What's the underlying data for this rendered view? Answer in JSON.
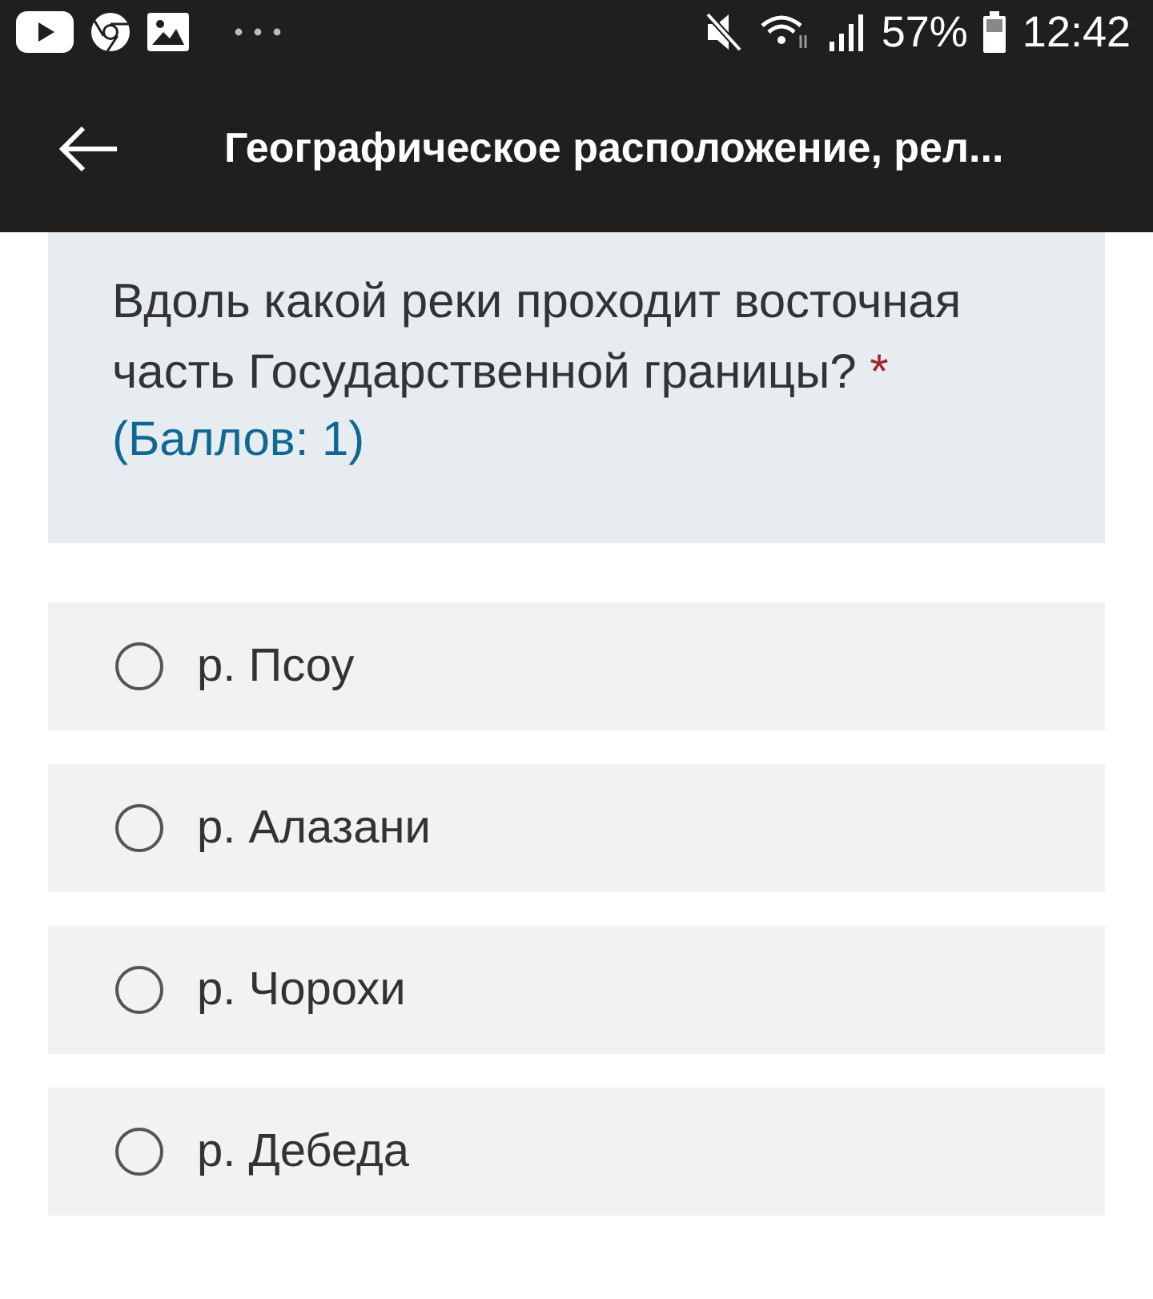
{
  "status_bar": {
    "battery": "57%",
    "time": "12:42"
  },
  "app_bar": {
    "title": "Географическое расположение, рел..."
  },
  "question": {
    "text": "Вдоль какой реки проходит восточная часть Государственной границы?",
    "required_mark": "*",
    "points": "(Баллов: 1)"
  },
  "options": [
    {
      "label": "р. Псоу",
      "selected": false
    },
    {
      "label": "р. Алазани",
      "selected": false
    },
    {
      "label": "р. Чорохи",
      "selected": false
    },
    {
      "label": "р. Дебеда",
      "selected": false
    }
  ]
}
